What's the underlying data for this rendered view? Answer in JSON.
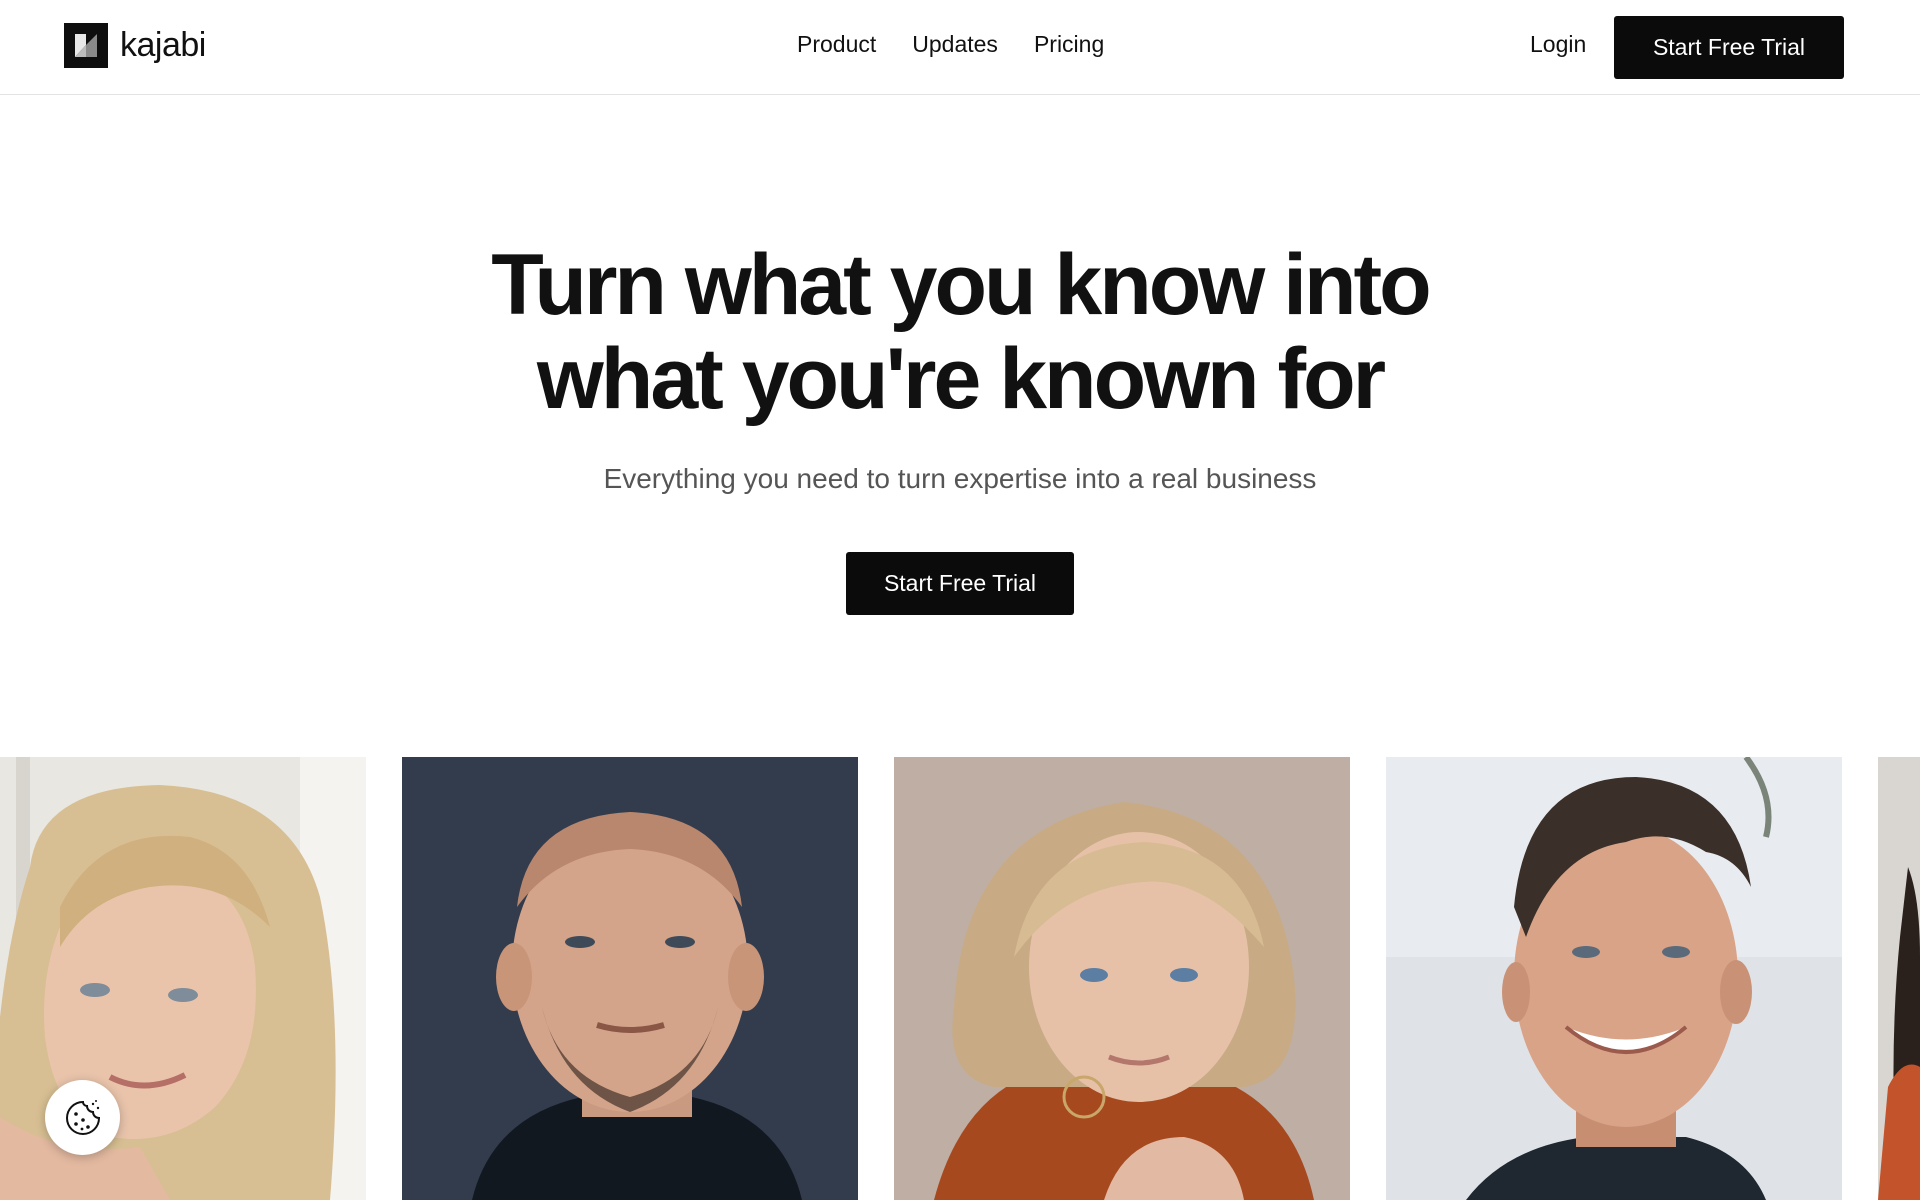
{
  "header": {
    "logo_text": "kajabi",
    "nav": [
      {
        "label": "Product"
      },
      {
        "label": "Updates"
      },
      {
        "label": "Pricing"
      }
    ],
    "login_label": "Login",
    "cta_label": "Start Free Trial"
  },
  "hero": {
    "title_line1": "Turn what you know into",
    "title_line2": "what you're known for",
    "subtitle": "Everything you need to turn expertise into a real business",
    "cta_label": "Start Free Trial"
  },
  "colors": {
    "primary": "#0b0b0b",
    "text": "#111111",
    "muted_text": "#555555",
    "background": "#ffffff"
  },
  "icons": {
    "logo": "kajabi-logo-icon",
    "cookie": "cookie-icon"
  }
}
